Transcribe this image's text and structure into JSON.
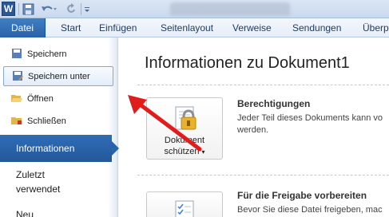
{
  "quick_access": {
    "app_icon": "W",
    "icons": [
      "save-icon",
      "undo-icon",
      "redo-icon",
      "customize-icon"
    ]
  },
  "ribbon": {
    "file_tab": "Datei",
    "tabs": [
      "Start",
      "Einfügen",
      "Seitenlayout",
      "Verweise",
      "Sendungen",
      "Überp"
    ]
  },
  "backstage_nav": {
    "save": "Speichern",
    "save_as": "Speichern unter",
    "open": "Öffnen",
    "close": "Schließen",
    "info": "Informationen",
    "recent_line1": "Zuletzt",
    "recent_line2": "verwendet",
    "new": "Neu"
  },
  "main": {
    "title": "Informationen zu Dokument1",
    "protect_button_line1": "Dokument",
    "protect_button_line2": "schützen",
    "permissions_heading": "Berechtigungen",
    "permissions_text_line1": "Jeder Teil dieses Dokuments kann vo",
    "permissions_text_line2": "werden.",
    "share_heading": "Für die Freigabe vorbereiten",
    "share_text_line1": "Bevor Sie diese Datei freigeben, mac"
  },
  "colors": {
    "file_tab": "#2a62a8",
    "info_selected": "#2a5fa3",
    "annotation_arrow": "#e21b1b"
  }
}
